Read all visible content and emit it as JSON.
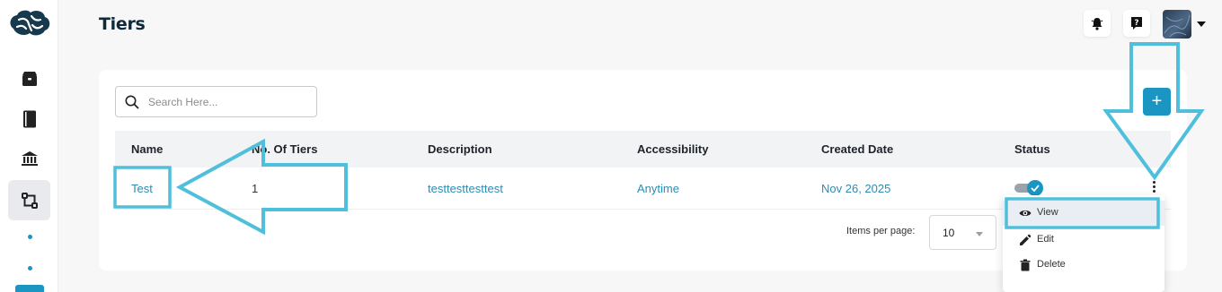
{
  "page": {
    "title": "Tiers"
  },
  "header": {
    "notifications_icon": "bell-icon",
    "help_icon": "help-icon"
  },
  "sidebar": {
    "items": [
      {
        "icon": "brain-logo-icon"
      },
      {
        "icon": "box-icon"
      },
      {
        "icon": "book-icon"
      },
      {
        "icon": "bank-icon"
      },
      {
        "icon": "workflow-icon",
        "active": true
      }
    ]
  },
  "search": {
    "placeholder": "Search Here..."
  },
  "table": {
    "columns": [
      "Name",
      "No. Of Tiers",
      "Description",
      "Accessibility",
      "Created Date",
      "Status"
    ],
    "rows": [
      {
        "name": "Test",
        "tiers": "1",
        "description": "testtesttesttest",
        "accessibility": "Anytime",
        "created": "Nov 26, 2025",
        "status": true
      }
    ]
  },
  "pagination": {
    "label": "Items per page:",
    "value": "10"
  },
  "row_menu": {
    "items": [
      "View",
      "Edit",
      "Delete"
    ]
  },
  "colors": {
    "accent": "#1b95c2",
    "annotation": "#4fbfdb"
  }
}
